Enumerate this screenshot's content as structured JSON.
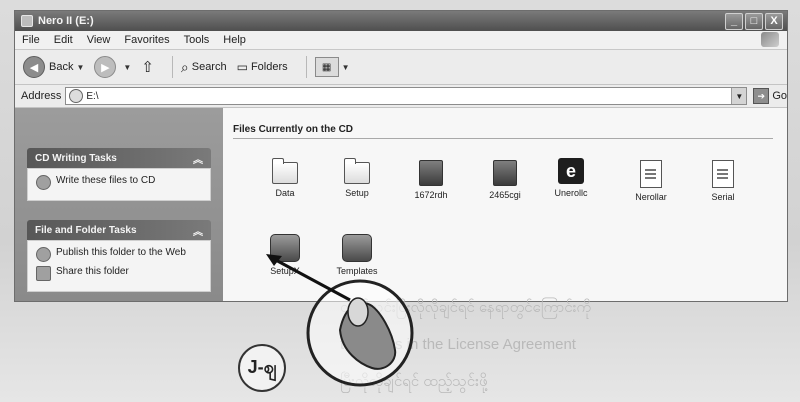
{
  "window": {
    "title": "Nero II (E:)",
    "controls": [
      "_",
      "□",
      "X"
    ]
  },
  "menu": [
    "File",
    "Edit",
    "View",
    "Favorites",
    "Tools",
    "Help"
  ],
  "toolbar": {
    "back": "Back",
    "search": "Search",
    "folders": "Folders"
  },
  "address": {
    "label": "Address",
    "value": "E:\\",
    "go": "Go"
  },
  "taskpane": {
    "cd_writing": {
      "title": "CD Writing Tasks",
      "items": [
        "Write these files to CD"
      ]
    },
    "file_folder": {
      "title": "File and Folder Tasks",
      "items": [
        "Publish this folder to the Web",
        "Share this folder"
      ]
    }
  },
  "content": {
    "group_title": "Files Currently on the CD",
    "items": [
      {
        "label": "Data",
        "icon": "folder-icon"
      },
      {
        "label": "Setup",
        "icon": "folder-icon"
      },
      {
        "label": "1672rdh",
        "icon": "executable-icon"
      },
      {
        "label": "2465cgi",
        "icon": "executable-icon"
      },
      {
        "label": "Unerollc",
        "icon": "ie-icon"
      },
      {
        "label": "Nerollar",
        "icon": "document-icon"
      },
      {
        "label": "Serial",
        "icon": "document-icon"
      },
      {
        "label": "SetupX",
        "icon": "installer-icon"
      },
      {
        "label": "Templates",
        "icon": "installer-icon"
      }
    ]
  },
  "annotation": {
    "callout": "J-ဈ"
  },
  "page_text": {
    "line1": "ထည့်သင်းပြီးလိုလိုချင်ရင် နေရာတွင်ကြောင်းကို",
    "line2": "the terms in the License Agreement",
    "line3": "ပြီးလိုလိုချင်ရင် ထည့်သွင်းဖို့"
  }
}
